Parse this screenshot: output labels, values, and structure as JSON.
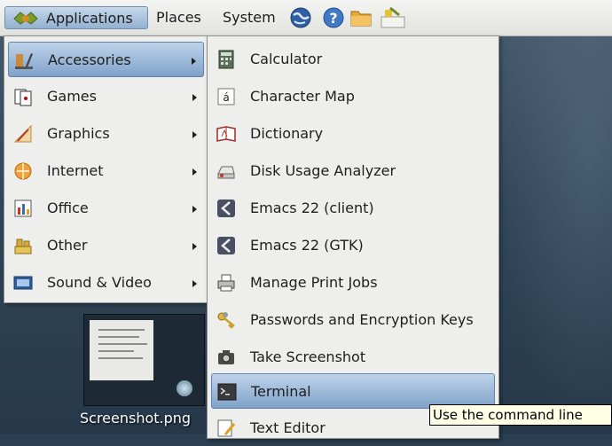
{
  "panel": {
    "menus": [
      "Applications",
      "Places",
      "System"
    ],
    "icons": [
      "globe-browser-icon",
      "help-icon",
      "folder-icon",
      "notes-icon"
    ]
  },
  "main_menu": {
    "items": [
      {
        "label": "Accessories",
        "icon": "accessories-icon",
        "highlighted": true
      },
      {
        "label": "Games",
        "icon": "games-cards-icon"
      },
      {
        "label": "Graphics",
        "icon": "graphics-icon"
      },
      {
        "label": "Internet",
        "icon": "internet-icon"
      },
      {
        "label": "Office",
        "icon": "office-icon"
      },
      {
        "label": "Other",
        "icon": "other-icon"
      },
      {
        "label": "Sound & Video",
        "icon": "sound-video-icon"
      }
    ]
  },
  "sub_menu": {
    "items": [
      {
        "label": "Calculator",
        "icon": "calculator-icon"
      },
      {
        "label": "Character Map",
        "icon": "character-map-icon"
      },
      {
        "label": "Dictionary",
        "icon": "dictionary-icon"
      },
      {
        "label": "Disk Usage Analyzer",
        "icon": "disk-usage-icon"
      },
      {
        "label": "Emacs 22 (client)",
        "icon": "emacs-icon"
      },
      {
        "label": "Emacs 22 (GTK)",
        "icon": "emacs-icon"
      },
      {
        "label": "Manage Print Jobs",
        "icon": "printer-icon"
      },
      {
        "label": "Passwords and Encryption Keys",
        "icon": "keys-icon"
      },
      {
        "label": "Take Screenshot",
        "icon": "camera-icon"
      },
      {
        "label": "Terminal",
        "icon": "terminal-icon",
        "highlighted": true
      },
      {
        "label": "Text Editor",
        "icon": "text-editor-icon"
      }
    ]
  },
  "desktop": {
    "file_label": "Screenshot.png"
  },
  "tooltip": "Use the command line",
  "colors": {
    "highlight_top": "#bfd3ea",
    "highlight_bottom": "#7fa2ca",
    "menu_bg": "#eeeeec",
    "tooltip_bg": "#ffffe6"
  }
}
